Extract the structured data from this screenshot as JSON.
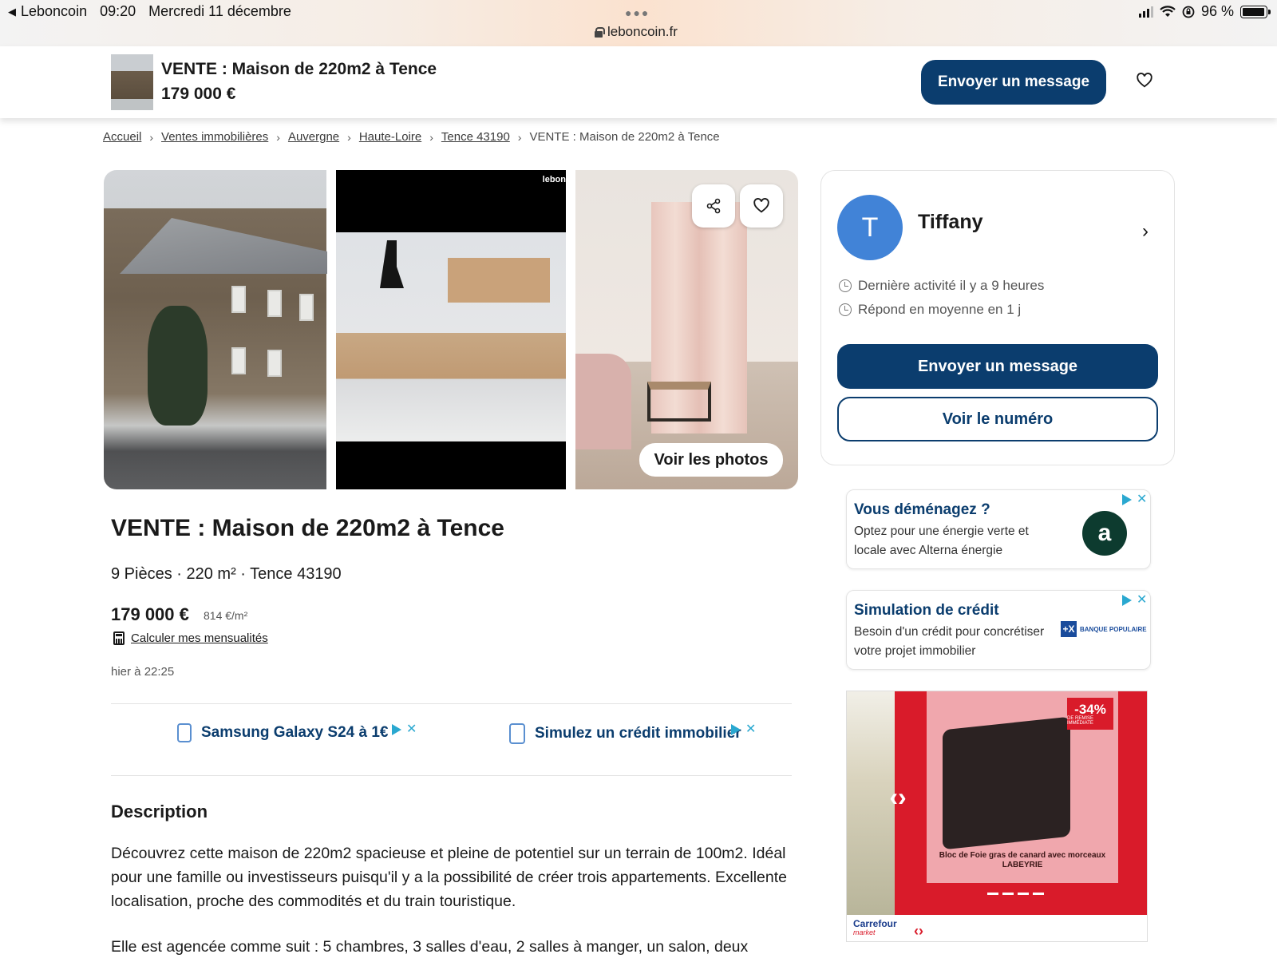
{
  "status_bar": {
    "back_app": "Leboncoin",
    "time": "09:20",
    "date": "Mercredi 11 décembre",
    "url": "leboncoin.fr",
    "battery": "96 %",
    "battery_level": 0.96
  },
  "sticky_header": {
    "title": "VENTE : Maison de 220m2 à Tence",
    "price": "179 000 €",
    "message_button": "Envoyer un message"
  },
  "breadcrumb": {
    "items": [
      "Accueil",
      "Ventes immobilières",
      "Auvergne",
      "Haute-Loire",
      "Tence 43190"
    ],
    "current": "VENTE : Maison de 220m2 à Tence"
  },
  "gallery": {
    "watermark": "lebon",
    "voir_photos": "Voir les photos"
  },
  "ad": {
    "title": "VENTE : Maison de 220m2 à Tence",
    "attributes": "9 Pièces · 220 m² · Tence 43190",
    "price": "179 000 €",
    "price_per_m2": "814 €/m²",
    "calc_link": "Calculer mes mensualités",
    "date": "hier à 22:25"
  },
  "promos": [
    {
      "label": "Samsung Galaxy S24 à 1€",
      "icon": "phone-icon"
    },
    {
      "label": "Simulez un crédit immobilier",
      "icon": "calculator-icon"
    }
  ],
  "description": {
    "title": "Description",
    "paragraph1": "Découvrez cette maison de 220m2 spacieuse et pleine de potentiel sur un terrain de 100m2. Idéal pour une famille ou investisseurs puisqu'il y a la possibilité de créer trois appartements. Excellente localisation, proche des commodités et du train touristique.",
    "paragraph2": "Elle est agencée comme suit : 5 chambres, 3 salles d'eau, 2 salles à manger, un salon, deux"
  },
  "seller": {
    "initial": "T",
    "name": "Tiffany",
    "last_activity": "Dernière activité il y a 9 heures",
    "response_time": "Répond en moyenne en 1 j",
    "message_button": "Envoyer un message",
    "phone_button": "Voir le numéro",
    "avatar_color": "#4183d7"
  },
  "side_ads": [
    {
      "title": "Vous déménagez ?",
      "text": "Optez pour une énergie verte et locale avec Alterna énergie",
      "logo": "a"
    },
    {
      "title": "Simulation de crédit",
      "text": "Besoin d'un crédit pour concrétiser votre projet immobilier",
      "logo": "BANQUE POPULAIRE"
    }
  ],
  "carrefour_ad": {
    "badge": "-34%",
    "badge_sub": "DE REMISE IMMÉDIATE",
    "product": "Bloc de Foie gras de canard avec morceaux LABEYRIE",
    "brand": "Carrefour",
    "brand_sub": "market"
  },
  "colors": {
    "primary": "#0b3d6e",
    "accent_blue": "#4183d7",
    "adchoice": "#2aa8d0"
  }
}
